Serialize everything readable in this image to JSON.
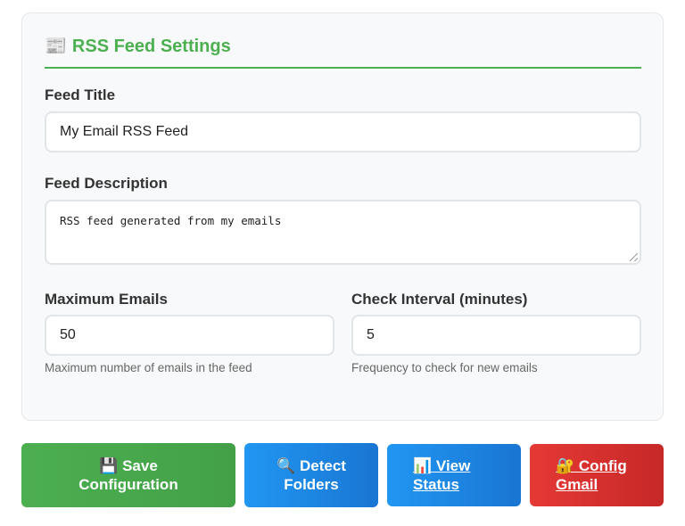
{
  "settings": {
    "icon": "newspaper-icon",
    "icon_glyph": "📰",
    "title": "RSS Feed Settings",
    "accent_color": "#4caf50"
  },
  "feed_title": {
    "label": "Feed Title",
    "value": "My Email RSS Feed"
  },
  "feed_description": {
    "label": "Feed Description",
    "value": "RSS feed generated from my emails"
  },
  "max_emails": {
    "label": "Maximum Emails",
    "value": "50",
    "help": "Maximum number of emails in the feed"
  },
  "check_interval": {
    "label": "Check Interval (minutes)",
    "value": "5",
    "help": "Frequency to check for new emails"
  },
  "buttons": {
    "save": {
      "icon": "floppy-disk-icon",
      "icon_glyph": "💾",
      "line1": "Save",
      "line2": "Configuration",
      "color": "#4caf50"
    },
    "detect": {
      "icon": "magnifier-icon",
      "icon_glyph": "🔍",
      "line1": "Detect",
      "line2": "Folders",
      "color": "#2196f3"
    },
    "status": {
      "icon": "bar-chart-icon",
      "icon_glyph": "📊",
      "line1": "View",
      "line2": "Status",
      "color": "#2196f3"
    },
    "gmail": {
      "icon": "lock-key-icon",
      "icon_glyph": "🔐",
      "line1": "Config",
      "line2": "Gmail",
      "color": "#e53935"
    }
  }
}
